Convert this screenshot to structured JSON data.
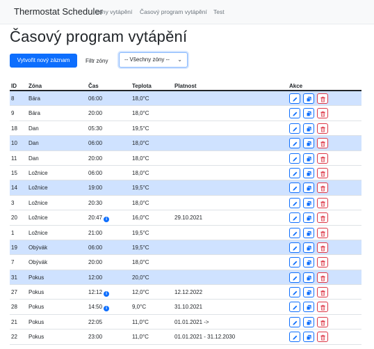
{
  "navbar": {
    "brand": "Thermostat Scheduler",
    "links": [
      "Zóny vytápění",
      "Časový program vytápění",
      "Test"
    ]
  },
  "page": {
    "title": "Časový program vytápění"
  },
  "toolbar": {
    "new_button": "Vytvořit nový záznam",
    "filter_label": "Filtr zóny",
    "filter_value": "-- Všechny zóny --"
  },
  "table": {
    "headers": [
      "ID",
      "Zóna",
      "Čas",
      "Teplota",
      "Platnost",
      "Akce"
    ],
    "rows": [
      {
        "id": "8",
        "zone": "Bára",
        "time": "06:00",
        "info": false,
        "temp": "18,0°C",
        "validity": "",
        "highlight": true
      },
      {
        "id": "9",
        "zone": "Bára",
        "time": "20:00",
        "info": false,
        "temp": "18,0°C",
        "validity": "",
        "highlight": false
      },
      {
        "id": "18",
        "zone": "Dan",
        "time": "05:30",
        "info": false,
        "temp": "19,5°C",
        "validity": "",
        "highlight": false
      },
      {
        "id": "10",
        "zone": "Dan",
        "time": "06:00",
        "info": false,
        "temp": "18,0°C",
        "validity": "",
        "highlight": true
      },
      {
        "id": "11",
        "zone": "Dan",
        "time": "20:00",
        "info": false,
        "temp": "18,0°C",
        "validity": "",
        "highlight": false
      },
      {
        "id": "15",
        "zone": "Ložnice",
        "time": "06:00",
        "info": false,
        "temp": "18,0°C",
        "validity": "",
        "highlight": false
      },
      {
        "id": "14",
        "zone": "Ložnice",
        "time": "19:00",
        "info": false,
        "temp": "19,5°C",
        "validity": "",
        "highlight": true
      },
      {
        "id": "3",
        "zone": "Ložnice",
        "time": "20:30",
        "info": false,
        "temp": "18,0°C",
        "validity": "",
        "highlight": false
      },
      {
        "id": "20",
        "zone": "Ložnice",
        "time": "20:47",
        "info": true,
        "temp": "16,0°C",
        "validity": "29.10.2021",
        "highlight": false
      },
      {
        "id": "1",
        "zone": "Ložnice",
        "time": "21:00",
        "info": false,
        "temp": "19,5°C",
        "validity": "",
        "highlight": false
      },
      {
        "id": "19",
        "zone": "Obývák",
        "time": "06:00",
        "info": false,
        "temp": "19,5°C",
        "validity": "",
        "highlight": true
      },
      {
        "id": "7",
        "zone": "Obývák",
        "time": "20:00",
        "info": false,
        "temp": "18,0°C",
        "validity": "",
        "highlight": false
      },
      {
        "id": "31",
        "zone": "Pokus",
        "time": "12:00",
        "info": false,
        "temp": "20,0°C",
        "validity": "",
        "highlight": true
      },
      {
        "id": "27",
        "zone": "Pokus",
        "time": "12:12",
        "info": true,
        "temp": "12,0°C",
        "validity": "12.12.2022",
        "highlight": false
      },
      {
        "id": "28",
        "zone": "Pokus",
        "time": "14:50",
        "info": true,
        "temp": "9,0°C",
        "validity": "31.10.2021",
        "highlight": false
      },
      {
        "id": "21",
        "zone": "Pokus",
        "time": "22:05",
        "info": false,
        "temp": "11,0°C",
        "validity": "01.01.2021 ->",
        "highlight": false
      },
      {
        "id": "22",
        "zone": "Pokus",
        "time": "23:00",
        "info": false,
        "temp": "11,0°C",
        "validity": "01.01.2021 - 31.12.2030",
        "highlight": false
      }
    ]
  },
  "icons": {
    "edit": "pencil-icon",
    "copy": "copy-icon",
    "delete": "trash-icon",
    "info": "info-circle-icon",
    "chevron": "chevron-down-icon"
  },
  "colors": {
    "primary": "#0d6efd",
    "danger": "#dc3545",
    "highlight_row": "#cfe2ff"
  }
}
